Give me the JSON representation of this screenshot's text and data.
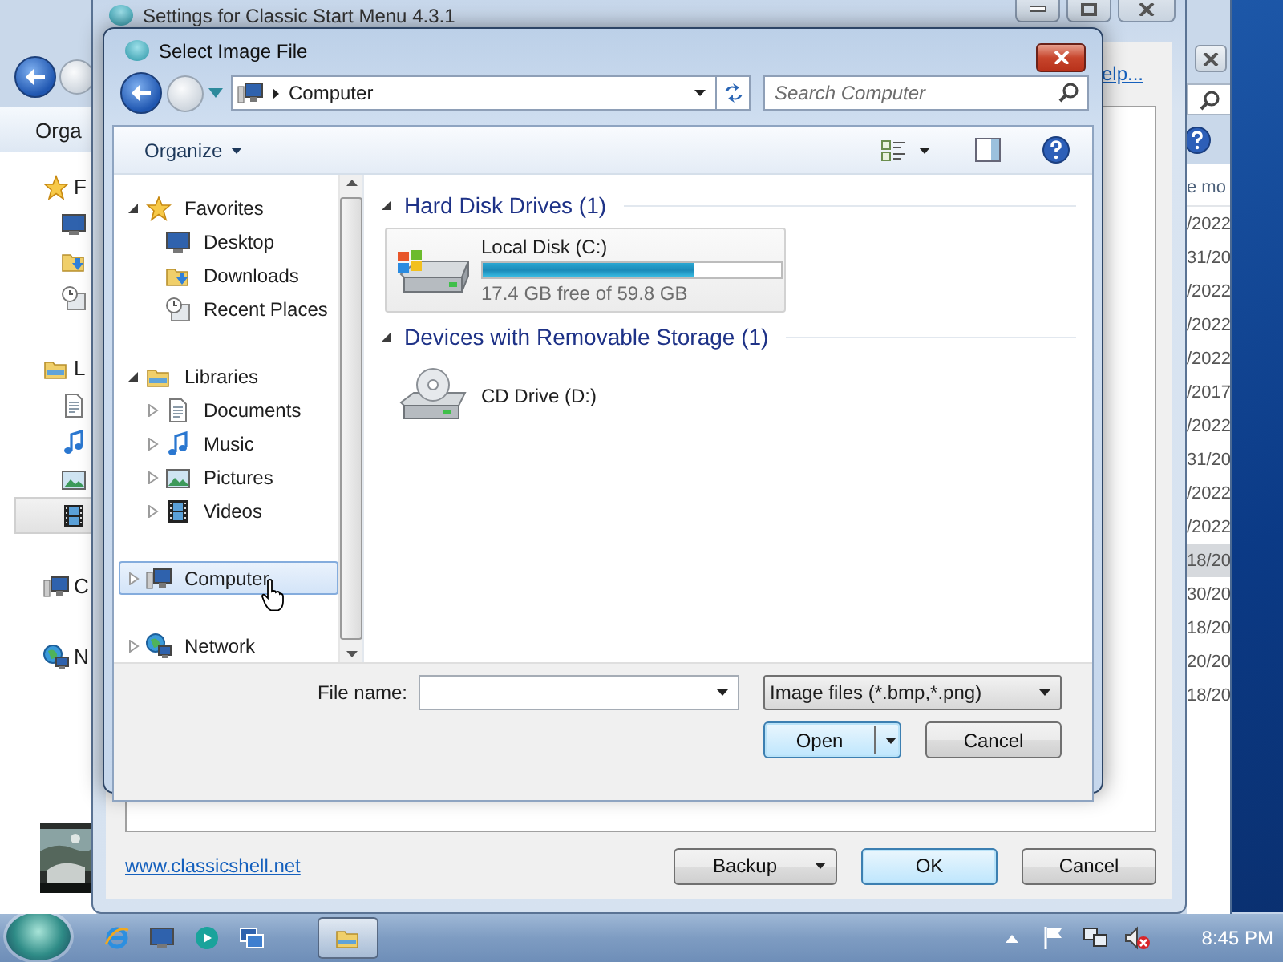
{
  "back_window": {
    "toolbar_label": "Orga",
    "nav_groups": [
      {
        "items": [
          {
            "kind": "star",
            "label": "F",
            "selected": false
          },
          {
            "kind": "desktop",
            "selected": false
          },
          {
            "kind": "downloads",
            "selected": false
          },
          {
            "kind": "recent",
            "selected": false
          }
        ]
      },
      {
        "items": [
          {
            "kind": "library",
            "label": "L",
            "selected": false
          },
          {
            "kind": "document",
            "selected": false
          },
          {
            "kind": "music",
            "selected": false
          },
          {
            "kind": "pictures",
            "selected": false
          },
          {
            "kind": "videos",
            "selected": true
          }
        ]
      },
      {
        "items": [
          {
            "kind": "computer",
            "label": "C",
            "selected": false
          }
        ]
      },
      {
        "items": [
          {
            "kind": "network",
            "label": "N",
            "selected": false
          }
        ]
      }
    ],
    "column_header": "e mo",
    "dates": [
      {
        "text": "/2022",
        "selected": false
      },
      {
        "text": "31/20",
        "selected": false
      },
      {
        "text": "/2022",
        "selected": false
      },
      {
        "text": "/2022",
        "selected": false
      },
      {
        "text": "/2022",
        "selected": false
      },
      {
        "text": "/2017",
        "selected": false
      },
      {
        "text": "/2022",
        "selected": false
      },
      {
        "text": "31/20",
        "selected": false
      },
      {
        "text": "/2022",
        "selected": false
      },
      {
        "text": "/2022",
        "selected": false
      },
      {
        "text": "18/20",
        "selected": true
      },
      {
        "text": "30/20",
        "selected": false
      },
      {
        "text": "18/20",
        "selected": false
      },
      {
        "text": "20/20",
        "selected": false
      },
      {
        "text": "18/20",
        "selected": false
      }
    ]
  },
  "settings_window": {
    "title": "Settings for Classic Start Menu 4.3.1",
    "help_link": "elp...",
    "website_link": "www.classicshell.net",
    "buttons": [
      {
        "label": "Backup",
        "kind": "menu"
      },
      {
        "label": "OK",
        "kind": "default"
      },
      {
        "label": "Cancel",
        "kind": "plain"
      }
    ]
  },
  "dialog": {
    "title": "Select Image File",
    "address": "Computer",
    "search_placeholder": "Search Computer",
    "organize": "Organize",
    "nav_tree": [
      {
        "kind": "star",
        "label": "Favorites",
        "expanded": true,
        "selected": false,
        "children": [
          {
            "kind": "desktop",
            "label": "Desktop",
            "selected": false
          },
          {
            "kind": "downloads",
            "label": "Downloads",
            "selected": false
          },
          {
            "kind": "recent",
            "label": "Recent Places",
            "selected": false
          }
        ]
      },
      {
        "kind": "library",
        "label": "Libraries",
        "expanded": true,
        "selected": false,
        "children": [
          {
            "kind": "document",
            "label": "Documents",
            "expanded": false,
            "selected": false
          },
          {
            "kind": "music",
            "label": "Music",
            "expanded": false,
            "selected": false
          },
          {
            "kind": "pictures",
            "label": "Pictures",
            "expanded": false,
            "selected": false
          },
          {
            "kind": "videos",
            "label": "Videos",
            "expanded": false,
            "selected": false
          }
        ]
      },
      {
        "kind": "computer",
        "label": "Computer",
        "expanded": false,
        "selected": true
      },
      {
        "kind": "network",
        "label": "Network",
        "expanded": false,
        "selected": false
      }
    ],
    "groups": [
      {
        "title": "Hard Disk Drives (1)",
        "expanded": true,
        "drives": [
          {
            "kind": "hdd",
            "name": "Local Disk (C:)",
            "level": 0.71,
            "detail": "17.4 GB free of 59.8 GB",
            "selected": true
          }
        ]
      },
      {
        "title": "Devices with Removable Storage (1)",
        "expanded": true,
        "drives": [
          {
            "kind": "cd",
            "name": "CD Drive (D:)",
            "selected": false
          }
        ]
      }
    ],
    "file_name_label": "File name:",
    "file_type": "Image files (*.bmp,*.png)",
    "buttons": [
      {
        "label": "Open",
        "kind": "split"
      },
      {
        "label": "Cancel",
        "kind": "plain"
      }
    ]
  },
  "taskbar": {
    "pinned": [
      {
        "kind": "ie",
        "selected": false
      },
      {
        "kind": "desktop",
        "selected": false
      },
      {
        "kind": "media",
        "selected": false
      },
      {
        "kind": "remote",
        "selected": false
      },
      {
        "kind": "explorer",
        "selected": true
      }
    ],
    "tray": [
      {
        "kind": "caret"
      },
      {
        "kind": "flag"
      },
      {
        "kind": "network"
      },
      {
        "kind": "muted"
      }
    ],
    "time": "8:45 PM"
  }
}
